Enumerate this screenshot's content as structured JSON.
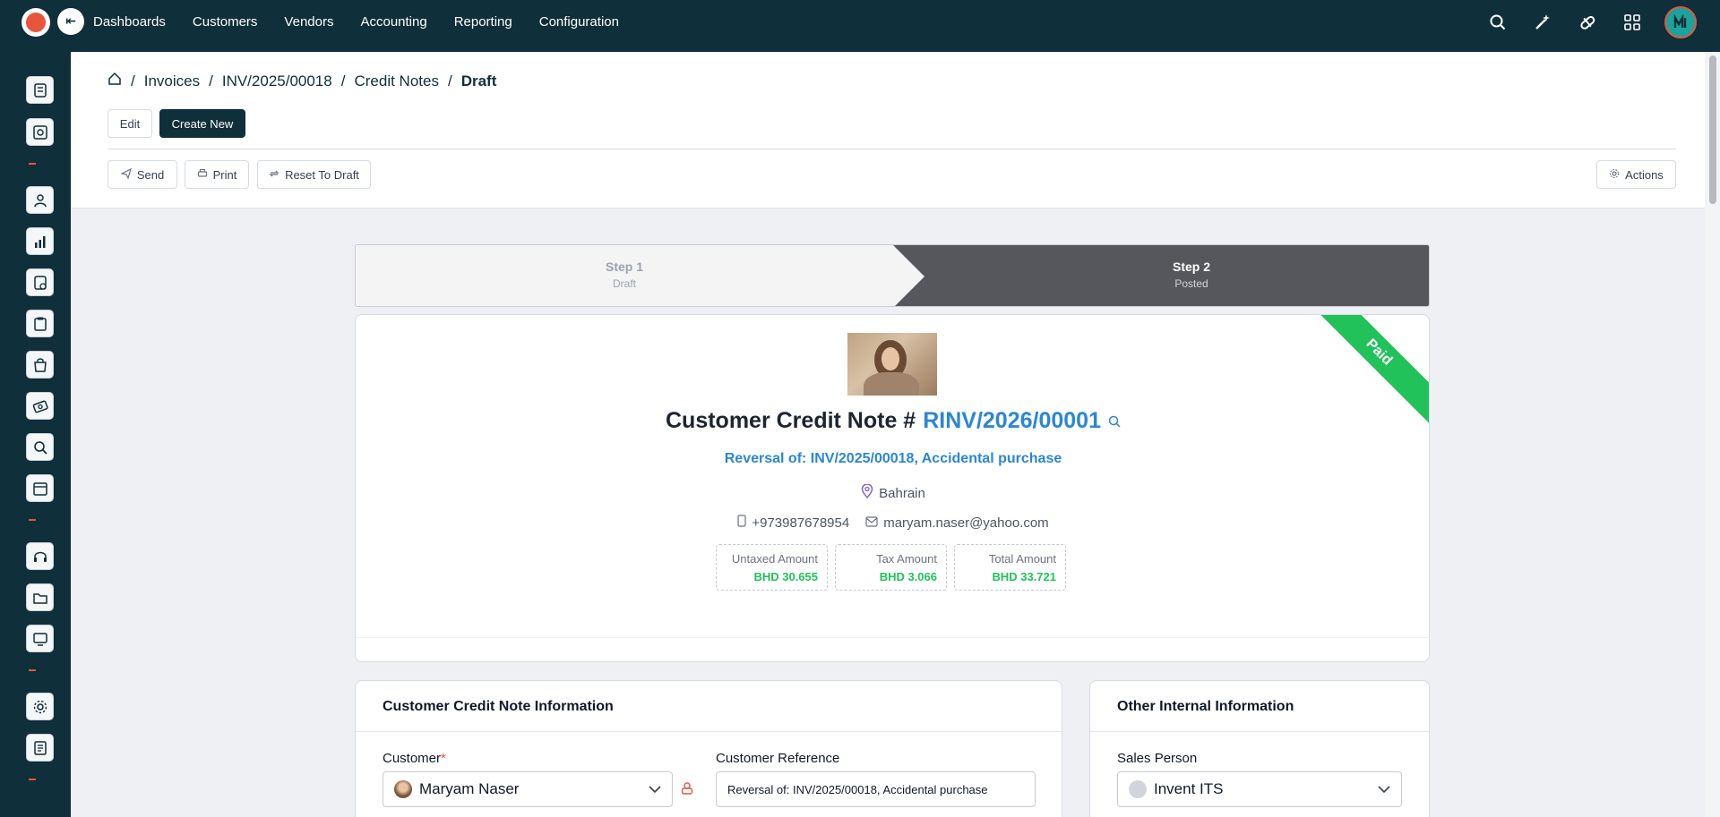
{
  "nav": {
    "items": [
      "Dashboards",
      "Customers",
      "Vendors",
      "Accounting",
      "Reporting",
      "Configuration"
    ]
  },
  "topbar_icons": [
    "search-icon",
    "magic-wand-icon",
    "pill-icon",
    "apps-grid-icon",
    "user-avatar"
  ],
  "sidebar_icons": [
    "module-1-icon",
    "module-2-icon",
    "module-3-icon",
    "chart-icon",
    "quote-icon",
    "clipboard-icon",
    "bag-icon",
    "banknote-icon",
    "magnifier-icon",
    "calendar-icon",
    "headset-icon",
    "folder-icon",
    "monitor-icon",
    "settings-icon",
    "document-icon"
  ],
  "breadcrumb": {
    "items": [
      "Invoices",
      "INV/2025/00018",
      "Credit Notes"
    ],
    "current": "Draft"
  },
  "toolbar": {
    "edit_label": "Edit",
    "create_label": "Create New",
    "send_label": "Send",
    "print_label": "Print",
    "reset_label": "Reset To Draft",
    "actions_label": "Actions"
  },
  "stepper": {
    "steps": [
      {
        "title": "Step 1",
        "subtitle": "Draft"
      },
      {
        "title": "Step 2",
        "subtitle": "Posted"
      }
    ],
    "active_index": 1
  },
  "summary": {
    "ribbon": "Paid",
    "title_prefix": "Customer Credit Note #",
    "number": "RINV/2026/00001",
    "reversal": "Reversal of: INV/2025/00018, Accidental purchase",
    "location": "Bahrain",
    "phone": "+973987678954",
    "email": "maryam.naser@yahoo.com",
    "amounts": [
      {
        "label": "Untaxed Amount",
        "value": "BHD 30.655"
      },
      {
        "label": "Tax Amount",
        "value": "BHD 3.066"
      },
      {
        "label": "Total Amount",
        "value": "BHD 33.721"
      }
    ]
  },
  "info": {
    "title": "Customer Credit Note Information",
    "customer_label": "Customer",
    "customer_value": "Maryam Naser",
    "reference_label": "Customer Reference",
    "reference_value": "Reversal of: INV/2025/00018, Accidental purchase"
  },
  "internal": {
    "title": "Other Internal Information",
    "sales_person_label": "Sales Person",
    "sales_person_value": "Invent ITS"
  },
  "colors": {
    "topbar": "#0f2f3a",
    "accent_blue": "#2b86d6",
    "paid_green": "#21c25a",
    "brand_orange": "#e8553c"
  }
}
